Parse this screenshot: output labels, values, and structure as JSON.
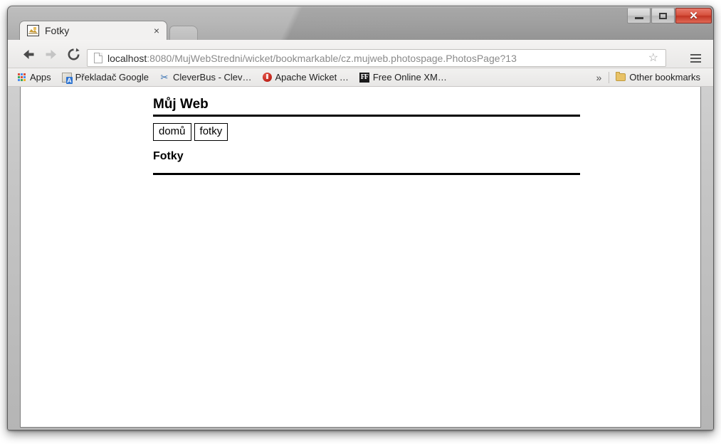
{
  "window": {
    "controls": {
      "minimize_label": "–",
      "maximize_label": "□",
      "close_label": "✕"
    }
  },
  "tab": {
    "title": "Fotky",
    "favicon": "broken-image-icon",
    "close_label": "×",
    "newtab_label": ""
  },
  "toolbar": {
    "back_label": "back-arrow-icon",
    "forward_label": "forward-arrow-icon",
    "reload_label": "reload-icon",
    "menu_label": "hamburger-menu-icon",
    "star_label": "☆"
  },
  "omnibox": {
    "page_icon": "page-icon",
    "url_host": "localhost",
    "url_rest": ":8080/MujWebStredni/wicket/bookmarkable/cz.mujweb.photospage.PhotosPage?13",
    "url_full": "localhost:8080/MujWebStredni/wicket/bookmarkable/cz.mujweb.photospage.PhotosPage?13"
  },
  "bookmarks": {
    "items": [
      {
        "label": "Apps",
        "icon": "apps-grid-icon"
      },
      {
        "label": "Překladač Google",
        "icon": "google-translate-icon"
      },
      {
        "label": "CleverBus - Clev…",
        "icon": "scissors-icon"
      },
      {
        "label": "Apache Wicket …",
        "icon": "apache-wicket-icon"
      },
      {
        "label": "Free Online XM…",
        "icon": "ff-icon"
      }
    ],
    "overflow_label": "»",
    "other_label": "Other bookmarks",
    "other_icon": "folder-icon"
  },
  "page": {
    "site_title": "Můj Web",
    "nav": [
      {
        "label": "domů"
      },
      {
        "label": "fotky"
      }
    ],
    "section_heading": "Fotky"
  },
  "colors": {
    "titlebar_gray": "#a8a8a8",
    "close_red": "#c23423",
    "toolbar_gray": "#eeedec",
    "page_white": "#ffffff",
    "rule_black": "#000000",
    "url_host_dark": "#2f2f2f",
    "url_rest_gray": "#8a8a8a"
  }
}
